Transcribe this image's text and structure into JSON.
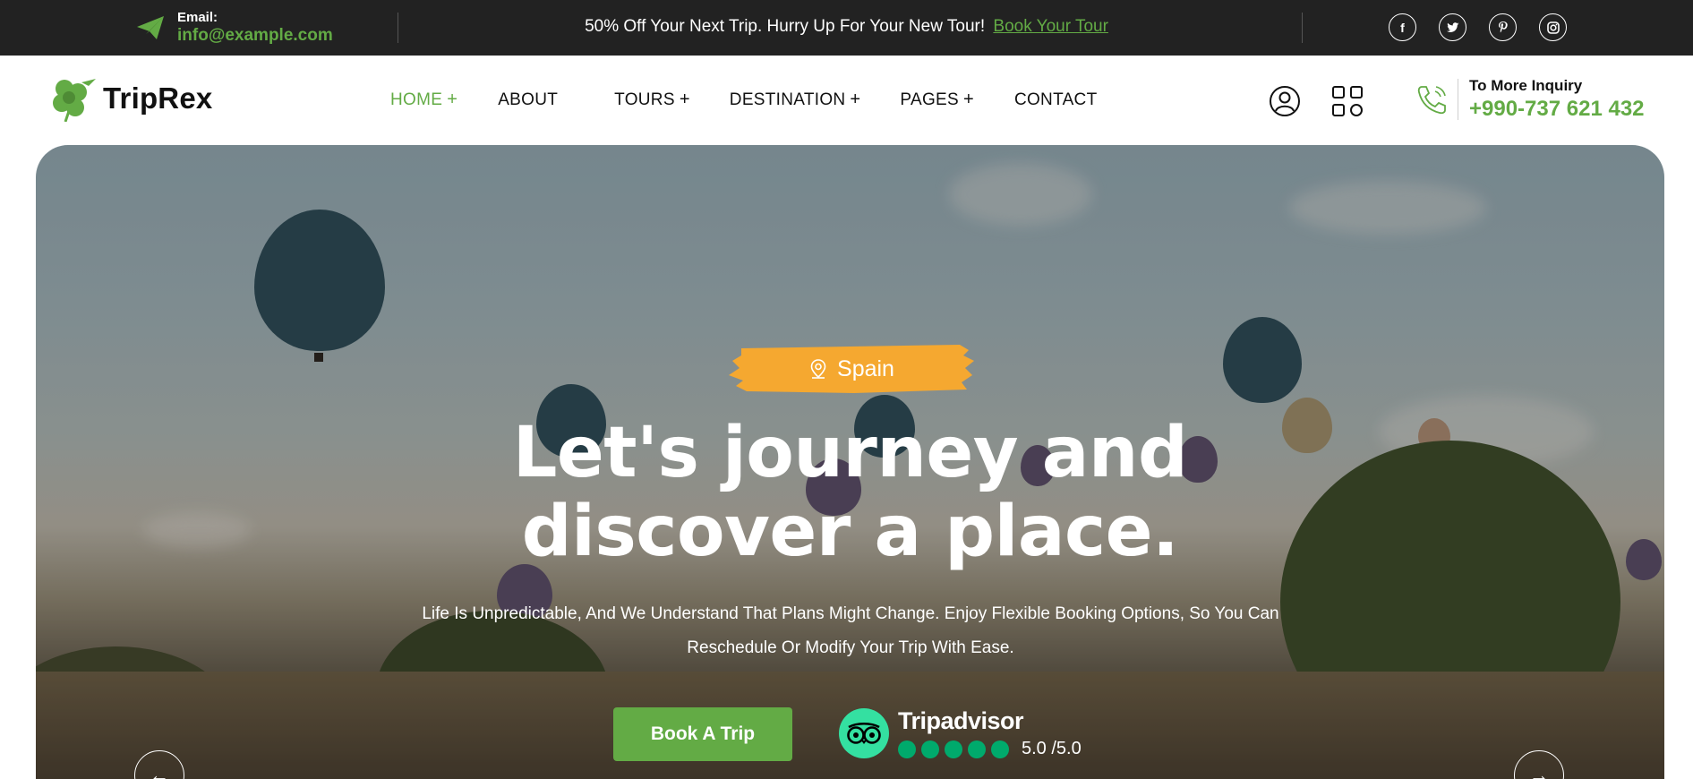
{
  "topbar": {
    "email_label": "Email:",
    "email_value": "info@example.com",
    "promo_text": "50% Off Your Next Trip. Hurry Up For Your New Tour!",
    "promo_link": "Book Your Tour",
    "socials": [
      {
        "name": "facebook",
        "glyph": "f"
      },
      {
        "name": "twitter",
        "glyph": "t"
      },
      {
        "name": "pinterest",
        "glyph": "p"
      },
      {
        "name": "instagram",
        "glyph": "◎"
      }
    ]
  },
  "header": {
    "logo_text": "TripRex",
    "nav": [
      {
        "label": "HOME",
        "plus": "+",
        "active": true
      },
      {
        "label": "ABOUT",
        "plus": ""
      },
      {
        "label": "TOURS",
        "plus": "+"
      },
      {
        "label": "DESTINATION",
        "plus": "+"
      },
      {
        "label": "PAGES",
        "plus": "+"
      },
      {
        "label": "CONTACT",
        "plus": ""
      }
    ],
    "inquiry_label": "To More Inquiry",
    "inquiry_number": "+990-737 621 432"
  },
  "hero": {
    "tag": "Spain",
    "headline_line1": "Let's journey and",
    "headline_line2": "discover a place.",
    "subline_line1": "Life Is Unpredictable, And We Understand That Plans Might Change. Enjoy Flexible Booking Options, So You Can",
    "subline_line2": "Reschedule Or Modify Your Trip With Ease.",
    "cta": "Book A Trip",
    "tripadvisor_name": "Tripadvisor",
    "tripadvisor_score": "5.0 /5.0",
    "rating_dots": 5,
    "prev_arrow": "←",
    "next_arrow": "→"
  },
  "colors": {
    "brand_green": "#63ab45",
    "topbar_bg": "#222222",
    "tag_orange": "#f5a830",
    "tripadvisor_green": "#34e0a1"
  }
}
